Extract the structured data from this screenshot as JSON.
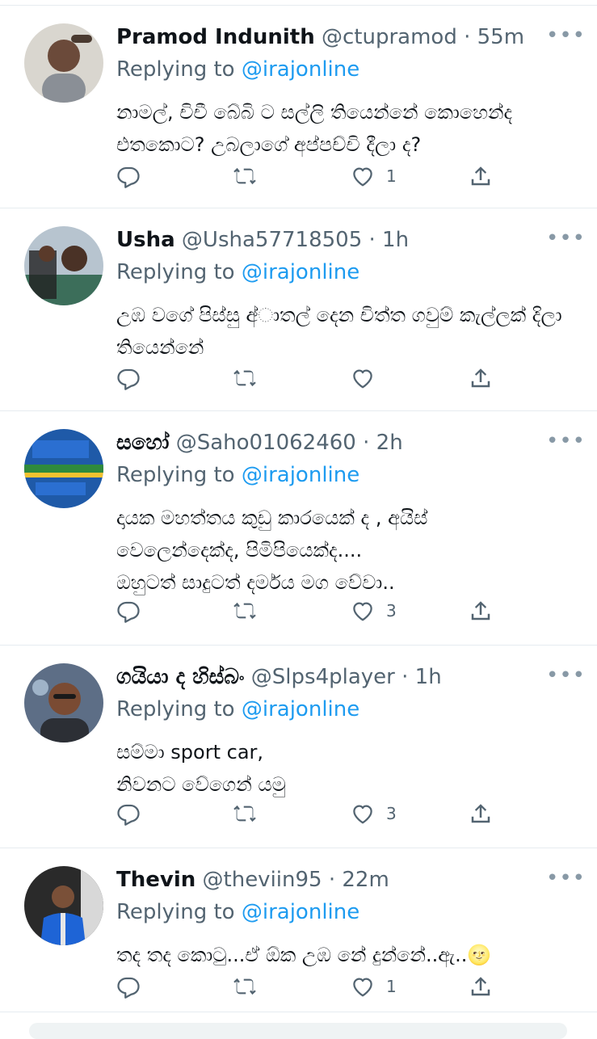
{
  "reply_prefix": "Replying to",
  "reply_handle": "@irajonline",
  "tweets": [
    {
      "name": "Pramod Indunith",
      "handle": "@ctupramod",
      "time": "55m",
      "text": "නාමල්, චිචී බේබි ට සල්ලි තියෙන්නේ කොහෙන්ද\nඑතකොට? උබලාගේ අප්පච්චි දීලා ද?",
      "likes": "1"
    },
    {
      "name": "Usha",
      "handle": "@Usha57718505",
      "time": "1h",
      "text": "උඹ වගේ පිස්සු අ්ාතල් දෙන චිත්ත ගවුම් කැල්ලක් දිලා\nතියෙන්නේ",
      "likes": ""
    },
    {
      "name": "සහෝ",
      "handle": "@Saho01062460",
      "time": "2h",
      "text": "දායක මහත්තය කුඩු කාරයෙක් ද , අයිස්\nවෙලෙන්දෙක්ද, පිමිපියෙක්ද....\nඔහුටත් සාදුටත් දර්මය මග වේවා..",
      "likes": "3"
    },
    {
      "name": "ගයියා ද හිස්බං",
      "handle": "@Slps4player",
      "time": "1h",
      "text": "සම්මා sport car,\nනිවනට වේගෙන් යමු",
      "likes": "3"
    },
    {
      "name": "Thevin",
      "handle": "@theviin95",
      "time": "22m",
      "text": "තද තද කොටු...ඒ ඕක උඹ නේ දුන්නේ..ඇ..🌝",
      "likes": "1"
    }
  ]
}
